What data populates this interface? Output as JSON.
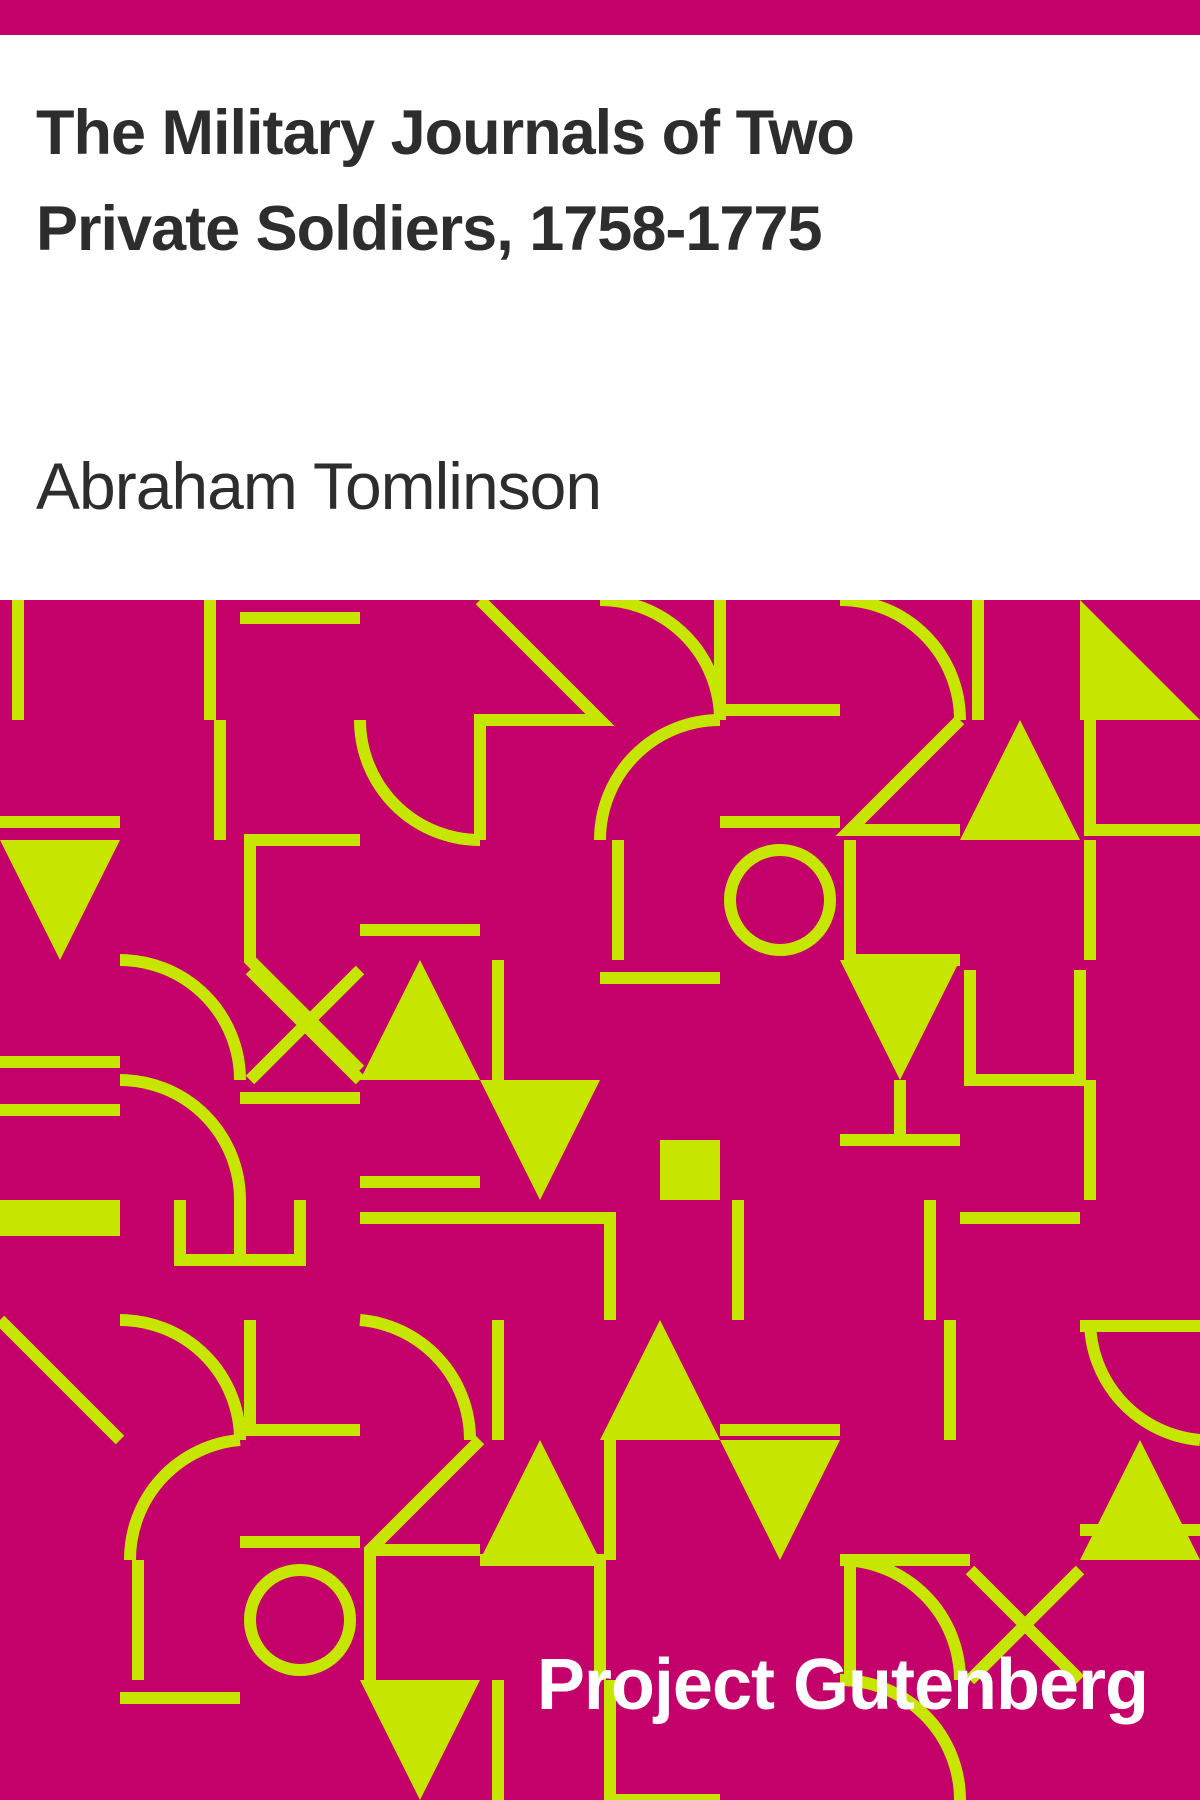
{
  "cover": {
    "title": "The Military Journals of Two Private Soldiers, 1758-1775",
    "author": "Abraham Tomlinson",
    "publisher": "Project Gutenberg"
  },
  "colors": {
    "accent": "#c4006a",
    "pattern_fg": "#c6e600",
    "text_dark": "#2d2d2d",
    "text_light": "#ffffff"
  }
}
